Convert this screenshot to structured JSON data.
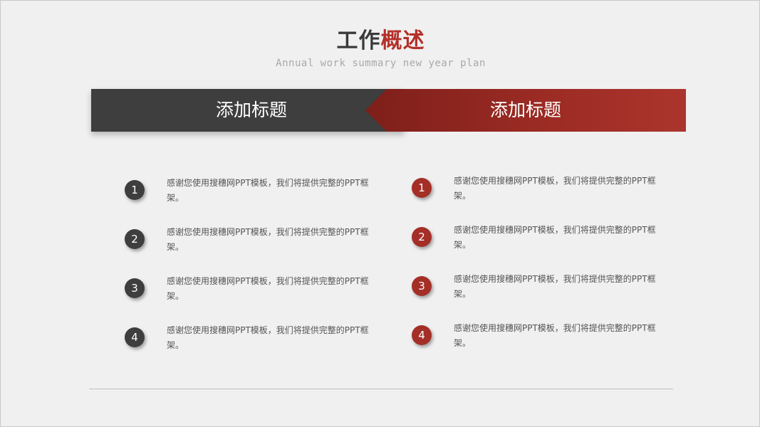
{
  "header": {
    "title_part1": "工作",
    "title_part2": "概述",
    "subtitle": "Annual work summary new year plan"
  },
  "banner": {
    "left_label": "添加标题",
    "right_label": "添加标题"
  },
  "left_list": [
    {
      "number": "1",
      "text": "感谢您使用搜穗网PPT模板，我们将提供完整的PPT框架。"
    },
    {
      "number": "2",
      "text": "感谢您使用搜穗网PPT模板，我们将提供完整的PPT框架。"
    },
    {
      "number": "3",
      "text": "感谢您使用搜穗网PPT模板，我们将提供完整的PPT框架。"
    },
    {
      "number": "4",
      "text": "感谢您使用搜穗网PPT模板，我们将提供完整的PPT框架。"
    }
  ],
  "right_list": [
    {
      "number": "1",
      "text": "感谢您使用搜穗网PPT模板，我们将提供完整的PPT框架。"
    },
    {
      "number": "2",
      "text": "感谢您使用搜穗网PPT模板，我们将提供完整的PPT框架。"
    },
    {
      "number": "3",
      "text": "感谢您使用搜穗网PPT模板，我们将提供完整的PPT框架。"
    },
    {
      "number": "4",
      "text": "感谢您使用搜穗网PPT模板，我们将提供完整的PPT框架。"
    }
  ],
  "colors": {
    "dark": "#3e3e3e",
    "accent": "#a42f27",
    "background": "#f0f0f0"
  }
}
